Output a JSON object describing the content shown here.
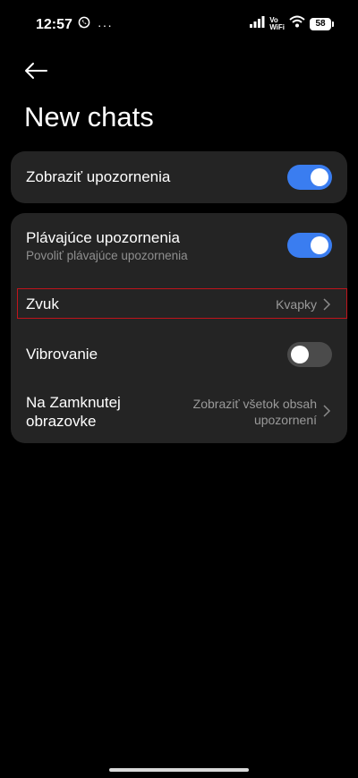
{
  "status_bar": {
    "time": "12:57",
    "more_dots": "···",
    "network_line1": "Vo",
    "network_line2": "WiFi",
    "battery": "58"
  },
  "header": {
    "title": "New chats"
  },
  "settings": {
    "show_notifications": {
      "label": "Zobraziť upozornenia",
      "enabled": true
    },
    "floating_notifications": {
      "label": "Plávajúce upozornenia",
      "subtitle": "Povoliť plávajúce upozornenia",
      "enabled": true
    },
    "sound": {
      "label": "Zvuk",
      "value": "Kvapky"
    },
    "vibration": {
      "label": "Vibrovanie",
      "enabled": false
    },
    "lock_screen": {
      "label_line1": "Na Zamknutej",
      "label_line2": "obrazovke",
      "value_line1": "Zobraziť všetok obsah",
      "value_line2": "upozornení"
    }
  },
  "colors": {
    "background": "#000000",
    "card": "#242424",
    "toggle_on": "#3a7df0",
    "toggle_off": "#4b4b4b",
    "highlight": "#c0141b"
  },
  "icons": [
    "whatsapp-icon",
    "signal-icon",
    "wifi-icon",
    "battery-icon",
    "back-arrow-icon",
    "chevron-right-icon"
  ]
}
